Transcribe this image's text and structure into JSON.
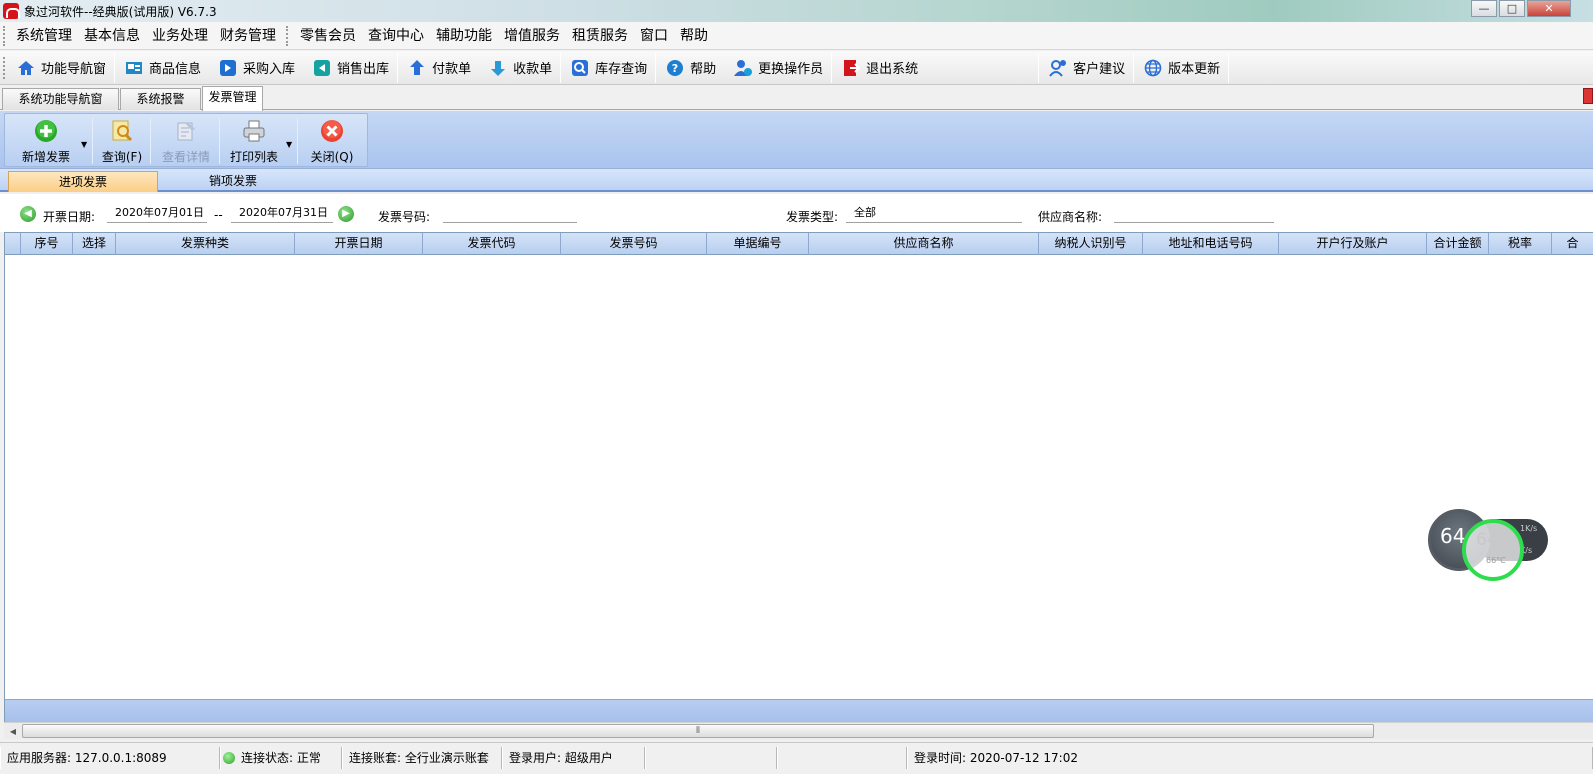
{
  "window": {
    "title": "象过河软件--经典版(试用版) V6.7.3",
    "minimize": "—",
    "maximize": "□",
    "close": "✕"
  },
  "menu": [
    "系统管理",
    "基本信息",
    "业务处理",
    "财务管理",
    "零售会员",
    "查询中心",
    "辅助功能",
    "增值服务",
    "租赁服务",
    "窗口",
    "帮助"
  ],
  "toolbar": {
    "nav": "功能导航窗",
    "goods": "商品信息",
    "purchase": "采购入库",
    "sales": "销售出库",
    "payment": "付款单",
    "receipt": "收款单",
    "stock": "库存查询",
    "help": "帮助",
    "switch_op": "更换操作员",
    "exit": "退出系统",
    "suggest": "客户建议",
    "update": "版本更新"
  },
  "doc_tabs": [
    "系统功能导航窗",
    "系统报警",
    "发票管理"
  ],
  "ribbon": {
    "add": "新增发票",
    "query": "查询(F)",
    "detail": "查看详情",
    "print": "打印列表",
    "close": "关闭(Q)"
  },
  "sub_tabs": [
    "进项发票",
    "销项发票"
  ],
  "filter": {
    "date_label": "开票日期:",
    "date_from": "2020年07月01日",
    "date_sep": "--",
    "date_to": "2020年07月31日",
    "invoice_no_label": "发票号码:",
    "invoice_no": "",
    "type_label": "发票类型:",
    "type_value": "全部",
    "supplier_label": "供应商名称:",
    "supplier": ""
  },
  "grid": {
    "columns": [
      "序号",
      "选择",
      "发票种类",
      "开票日期",
      "发票代码",
      "发票号码",
      "单据编号",
      "供应商名称",
      "纳税人识别号",
      "地址和电话号码",
      "开户行及账户",
      "合计金额",
      "税率",
      "合"
    ],
    "rows": []
  },
  "scrollbar": {
    "thumb_grip": "⦀"
  },
  "status": {
    "server": "应用服务器: 127.0.0.1:8089",
    "conn": "连接状态: 正常",
    "account": "连接账套: 全行业演示账套",
    "user": "登录用户: 超级用户",
    "login_time": "登录时间: 2020-07-12 17:02"
  },
  "widget": {
    "big": "64",
    "pct": "64",
    "pct_unit": "%",
    "temp": "66°C",
    "rate_up": "1K/s",
    "rate_down": "K/s"
  },
  "colors": {
    "ribbon": "#b8cff2",
    "active_subtab": "#fbce86",
    "status_ok": "#2ea12a",
    "widget_ring": "#2fdc4e"
  }
}
